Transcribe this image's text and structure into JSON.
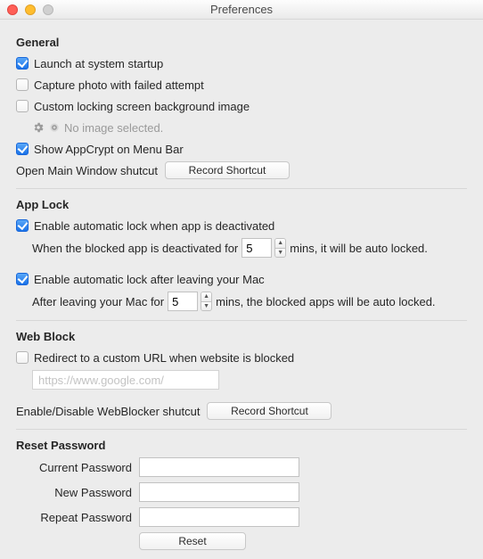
{
  "window": {
    "title": "Preferences"
  },
  "general": {
    "title": "General",
    "launch_startup": {
      "label": "Launch at system startup",
      "checked": true
    },
    "capture_photo": {
      "label": "Capture photo with failed attempt",
      "checked": false
    },
    "custom_lock_bg": {
      "label": "Custom locking screen background image",
      "checked": false
    },
    "no_image_text": "No image selected.",
    "show_menubar": {
      "label": "Show AppCrypt on Menu Bar",
      "checked": true
    },
    "open_main_shortcut_label": "Open Main Window shutcut",
    "record_shortcut_btn": "Record Shortcut"
  },
  "applock": {
    "title": "App Lock",
    "auto_lock_deactivated": {
      "label": "Enable automatic lock when app is deactivated",
      "checked": true
    },
    "deact_prefix": "When the blocked app is deactivated for",
    "deact_value": "5",
    "deact_suffix": "mins, it will be auto locked.",
    "auto_lock_leave": {
      "label": "Enable automatic lock after leaving your Mac",
      "checked": true
    },
    "leave_prefix": "After leaving your Mac for",
    "leave_value": "5",
    "leave_suffix": "mins, the blocked apps will be auto locked."
  },
  "webblock": {
    "title": "Web Block",
    "redirect": {
      "label": "Redirect to a custom URL when website is blocked",
      "checked": false
    },
    "url_placeholder": "https://www.google.com/",
    "url_value": "",
    "enable_disable_label": "Enable/Disable WebBlocker shutcut",
    "record_shortcut_btn": "Record Shortcut"
  },
  "reset": {
    "title": "Reset Password",
    "current_label": "Current Password",
    "new_label": "New Password",
    "repeat_label": "Repeat Password",
    "reset_btn": "Reset"
  }
}
